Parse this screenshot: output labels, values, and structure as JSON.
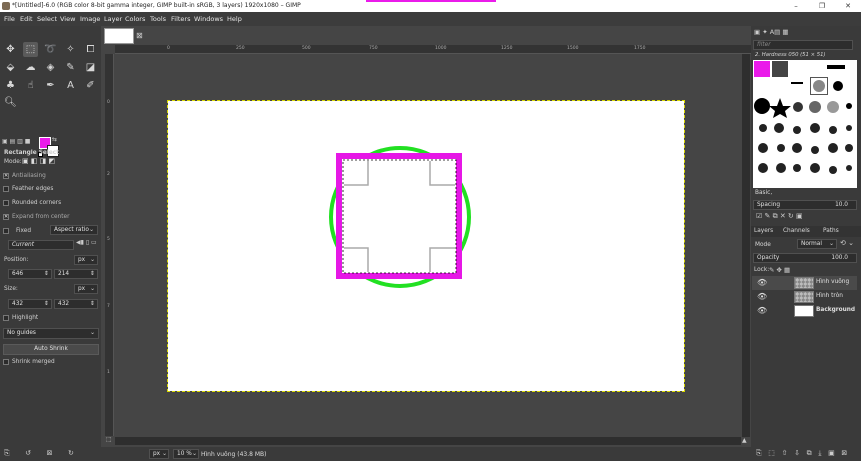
{
  "window": {
    "title": "*[Untitled]-6.0 (RGB color 8-bit gamma integer, GIMP built-in sRGB, 3 layers) 1920x1080 – GIMP",
    "minimize": "–",
    "maximize": "❐",
    "close": "✕"
  },
  "menubar": [
    "File",
    "Edit",
    "Select",
    "View",
    "Image",
    "Layer",
    "Colors",
    "Tools",
    "Filters",
    "Windows",
    "Help"
  ],
  "colors": {
    "foreground": "#ea1bea",
    "background": "#ffffff",
    "circle": "#22e022",
    "square": "#e617e6"
  },
  "tool_options": {
    "title": "Rectangle Select",
    "mode_label": "Mode:",
    "antialiasing": "Antialiasing",
    "feather_edges": "Feather edges",
    "rounded_corners": "Rounded corners",
    "expand_from_center": "Expand from center",
    "fixed": "Fixed",
    "fixed_select": "Aspect ratio",
    "current": "Current",
    "position_label": "Position:",
    "position_unit": "px",
    "position_x": "646",
    "position_y": "214",
    "size_label": "Size:",
    "size_unit": "px",
    "size_w": "432",
    "size_h": "432",
    "highlight": "Highlight",
    "guides": "No guides",
    "auto_shrink": "Auto Shrink",
    "shrink_merged": "Shrink merged"
  },
  "rulers": {
    "h": [
      "0",
      "250",
      "500",
      "750",
      "1000",
      "1250",
      "1500",
      "1750"
    ],
    "v": [
      "0",
      "2",
      "5",
      "7",
      "1"
    ]
  },
  "statusbar": {
    "unit": "px",
    "zoom": "10 %",
    "message": "Hình vuông (43.8 MB)"
  },
  "brushes": {
    "filter_placeholder": "filter",
    "brush_name": "2. Hardness 050 (51 × 51)",
    "preset": "Basic,",
    "spacing_label": "Spacing",
    "spacing_value": "10.0"
  },
  "layers_panel": {
    "tabs": [
      "Layers",
      "Channels",
      "Paths"
    ],
    "mode_label": "Mode",
    "mode_value": "Normal",
    "opacity_label": "Opacity",
    "opacity_value": "100.0",
    "lock_label": "Lock:",
    "layers": [
      {
        "name": "Hình vuông"
      },
      {
        "name": "Hình tròn"
      },
      {
        "name": "Background"
      }
    ]
  }
}
